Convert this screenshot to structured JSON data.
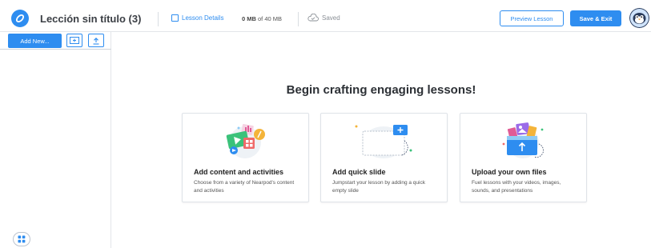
{
  "header": {
    "title": "Lección sin título (3)",
    "lesson_details": "Lesson Details",
    "storage_used": "0 MB",
    "storage_total": "of 40 MB",
    "saved": "Saved",
    "preview_label": "Preview Lesson",
    "save_exit_label": "Save & Exit",
    "accent": "#2e8df0"
  },
  "sidebar": {
    "add_new_label": "Add New...",
    "icons": [
      "add-slide-icon",
      "upload-icon",
      "grid-menu-icon"
    ]
  },
  "main": {
    "heading": "Begin crafting engaging lessons!",
    "cards": [
      {
        "title": "Add content and activities",
        "description": "Choose from a variety of Nearpod's content and activities",
        "icon": "content-activities-illustration"
      },
      {
        "title": "Add quick slide",
        "description": "Jumpstart your lesson by adding a quick empty slide",
        "icon": "quick-slide-illustration"
      },
      {
        "title": "Upload your own files",
        "description": "Fuel lessons with your videos, images, sounds, and presentations",
        "icon": "upload-files-illustration"
      }
    ]
  }
}
